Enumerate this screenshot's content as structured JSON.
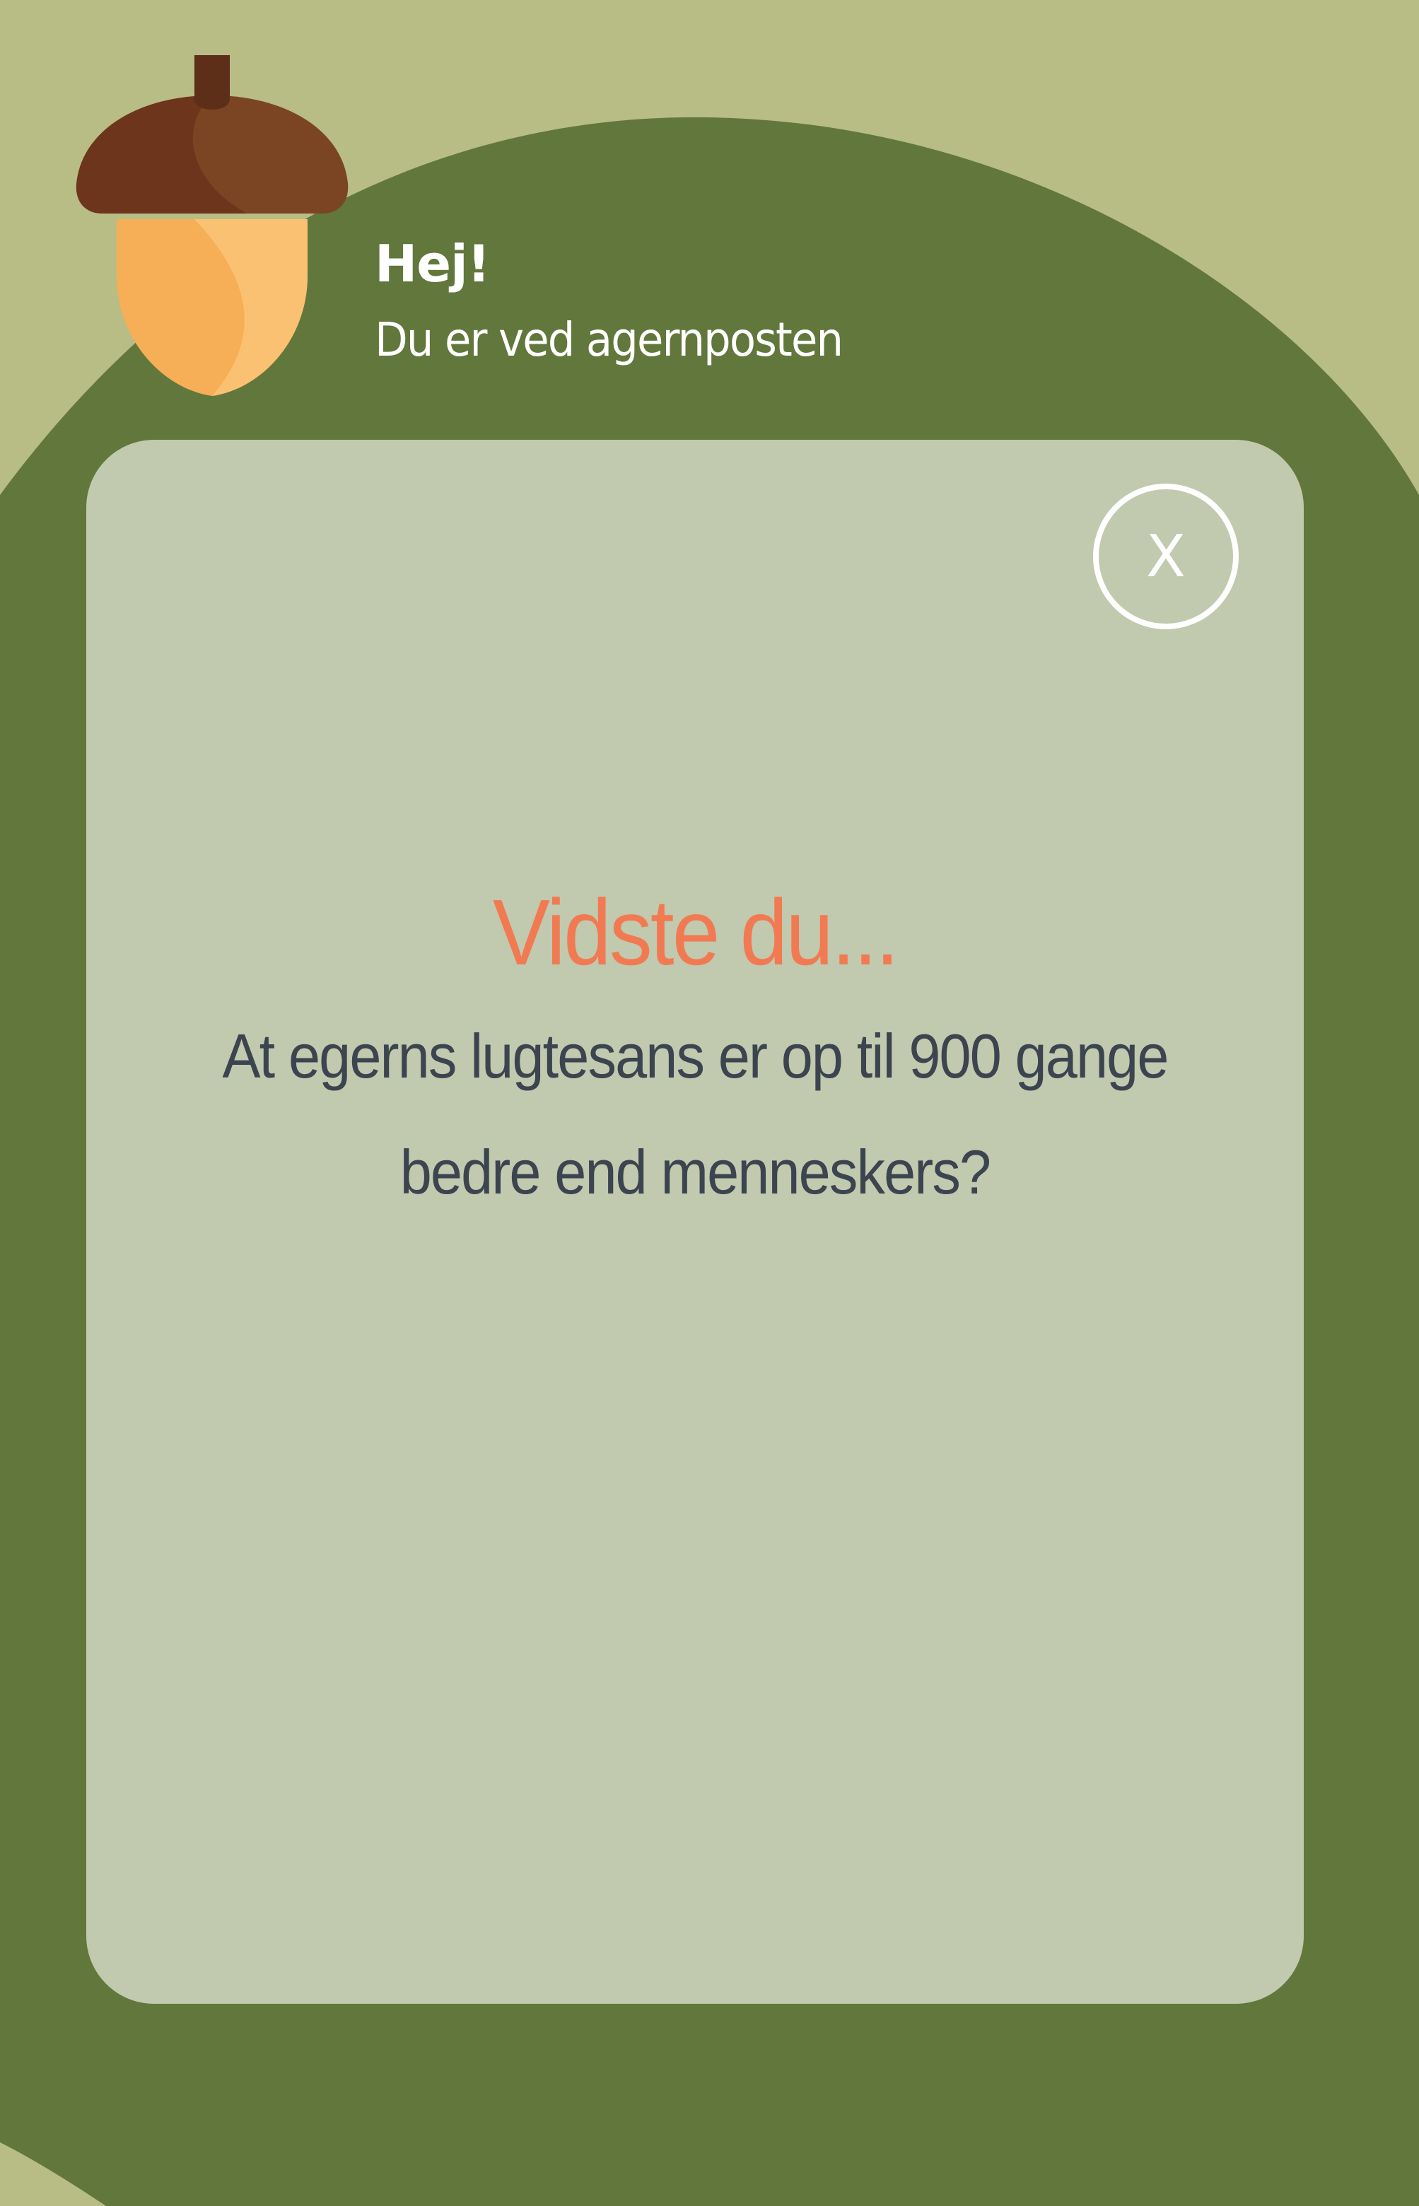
{
  "colors": {
    "outer_background": "#b8bd85",
    "dark_green": "#62773c",
    "card_background": "#c1c9af",
    "accent_orange": "#f17a52",
    "body_text": "#3c4450",
    "white": "#ffffff"
  },
  "header": {
    "icon": "acorn-icon",
    "greeting": "Hej!",
    "location": "Du er ved agernposten"
  },
  "card": {
    "close_label": "X",
    "fact_title": "Vidste du...",
    "fact_text_line1": "At egerns lugtesans er op til 900 gange",
    "fact_text_line2": "bedre end menneskers?"
  }
}
